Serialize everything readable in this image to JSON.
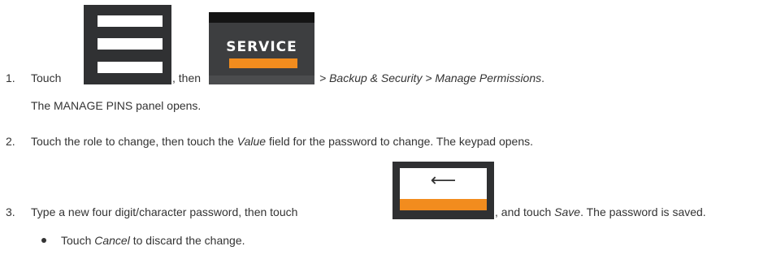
{
  "steps": [
    {
      "number": "1.",
      "touch_label": "Touch",
      "then_label": ", then",
      "path_label": "> Backup & Security > Manage Permissions",
      "path_end": ".",
      "note": "The MANAGE PINS panel opens."
    },
    {
      "number": "2.",
      "text_before": "Touch the role to change, then touch the",
      "field_name": "Value",
      "text_after": "field for the password to change. The keypad opens."
    },
    {
      "number": "3.",
      "text_before": "Type a new four digit/character password, then touch",
      "text_middle": ", and touch",
      "save_label": "Save",
      "text_after": ". The password is saved."
    }
  ],
  "bullet": {
    "touch_label": "Touch",
    "cancel_label": "Cancel",
    "text_after": "to discard the change."
  },
  "icons": {
    "menu": "menu-icon",
    "service": "service-button-icon",
    "enter": "enter-key-icon"
  },
  "service_button": {
    "label": "SERVICE"
  },
  "colors": {
    "accent": "#f28c1e",
    "button_dark": "#303133",
    "text": "#333333"
  }
}
